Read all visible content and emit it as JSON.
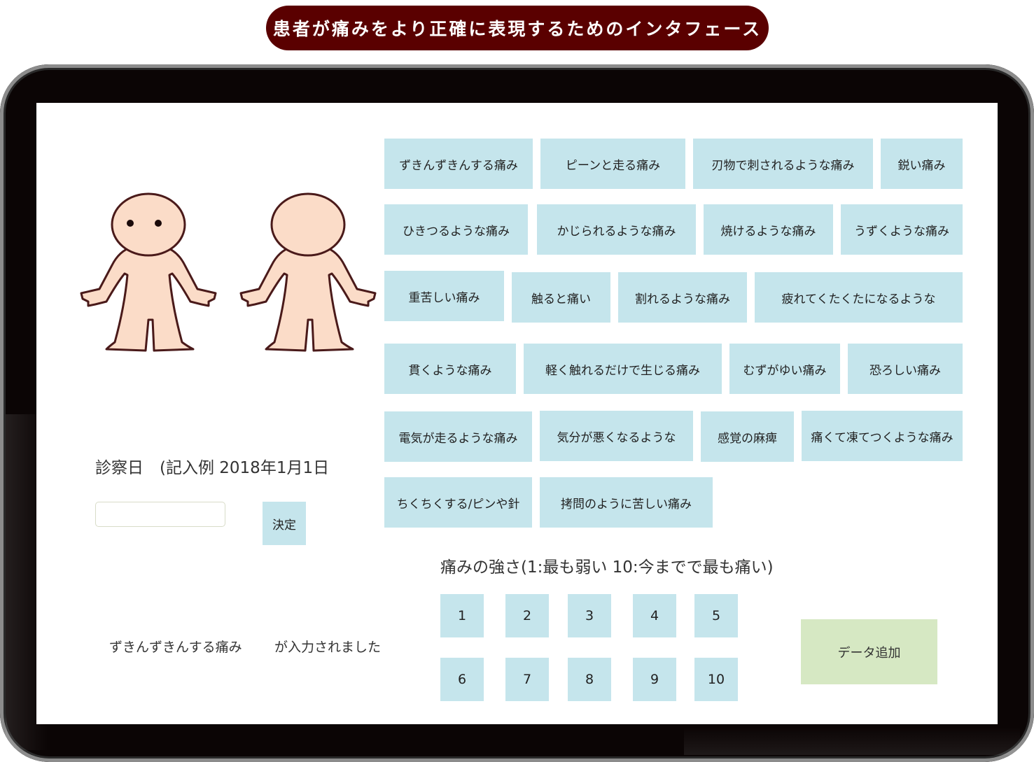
{
  "page_title": "患者が痛みをより正確に表現するためのインタフェース",
  "pain_types": [
    "ずきんずきんする痛み",
    "ピーンと走る痛み",
    "刃物で刺されるような痛み",
    "鋭い痛み",
    "ひきつるような痛み",
    "かじられるような痛み",
    "焼けるような痛み",
    "うずくような痛み",
    "重苦しい痛み",
    "触ると痛い",
    "割れるような痛み",
    "疲れてくたくたになるような",
    "貫くような痛み",
    "軽く触れるだけで生じる痛み",
    "むずがゆい痛み",
    "恐ろしい痛み",
    "電気が走るような痛み",
    "気分が悪くなるような",
    "感覚の麻痺",
    "痛くて凍てつくような痛み",
    "ちくちくする/ピンや針",
    "拷問のように苦しい痛み"
  ],
  "exam_date": {
    "label": "診察日　(記入例 2018年1月1日",
    "value": "",
    "decide_label": "決定"
  },
  "status": {
    "selected_pain": "ずきんずきんする痛み",
    "suffix": "が入力されました"
  },
  "intensity": {
    "label": "痛みの強さ(1:最も弱い 10:今までで最も痛い)",
    "levels": [
      "1",
      "2",
      "3",
      "4",
      "5",
      "6",
      "7",
      "8",
      "9",
      "10"
    ]
  },
  "add_data_label": "データ追加",
  "colors": {
    "title_bg": "#5a0000",
    "button_bg": "#c5e5ec",
    "add_button_bg": "#d6e8c3",
    "skin": "#fbdcc8",
    "outline": "#4a1a1a"
  },
  "icons": [
    "body-front-icon",
    "body-back-icon"
  ]
}
